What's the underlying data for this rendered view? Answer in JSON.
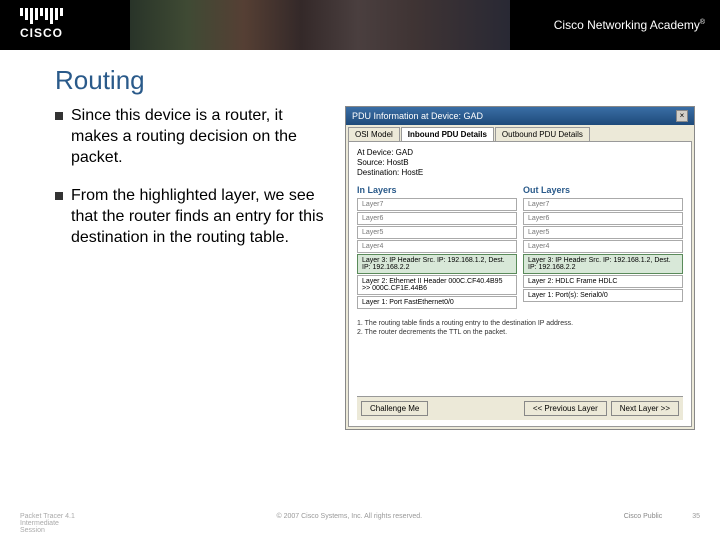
{
  "header": {
    "brand": "CISCO",
    "academy": "Cisco Networking Academy"
  },
  "title": "Routing",
  "bullets": [
    "Since this device is a router, it makes a routing decision on the packet.",
    "From the highlighted layer, we see that the router finds an entry for this destination in the routing table."
  ],
  "pdu": {
    "window_title": "PDU Information at Device: GAD",
    "tabs": [
      "OSI Model",
      "Inbound PDU Details",
      "Outbound PDU Details"
    ],
    "info": {
      "at_device": "At Device: GAD",
      "source": "Source: HostB",
      "destination": "Destination: HostE"
    },
    "in_header": "In Layers",
    "out_header": "Out Layers",
    "in_layers": {
      "l7": "Layer7",
      "l6": "Layer6",
      "l5": "Layer5",
      "l4": "Layer4",
      "l3": "Layer 3: IP Header Src. IP: 192.168.1.2, Dest. IP: 192.168.2.2",
      "l2": "Layer 2: Ethernet II Header 000C.CF40.4B95 >> 000C.CF1E.44B6",
      "l1": "Layer 1: Port FastEthernet0/0"
    },
    "out_layers": {
      "l7": "Layer7",
      "l6": "Layer6",
      "l5": "Layer5",
      "l4": "Layer4",
      "l3": "Layer 3: IP Header Src. IP: 192.168.1.2, Dest. IP: 192.168.2.2",
      "l2": "Layer 2: HDLC Frame HDLC",
      "l1": "Layer 1: Port(s): Serial0/0"
    },
    "notes": [
      "1.  The routing table finds a routing entry to the destination IP address.",
      "2.  The router decrements the TTL on the packet."
    ],
    "buttons": {
      "challenge": "Challenge Me",
      "prev": "<< Previous Layer",
      "next": "Next Layer >>"
    }
  },
  "footer": {
    "left1": "Packet Tracer 4.1",
    "left2": "Intermediate",
    "left3": "Session",
    "center": "© 2007 Cisco Systems, Inc. All rights reserved.",
    "right": "Cisco Public",
    "page": "35"
  }
}
